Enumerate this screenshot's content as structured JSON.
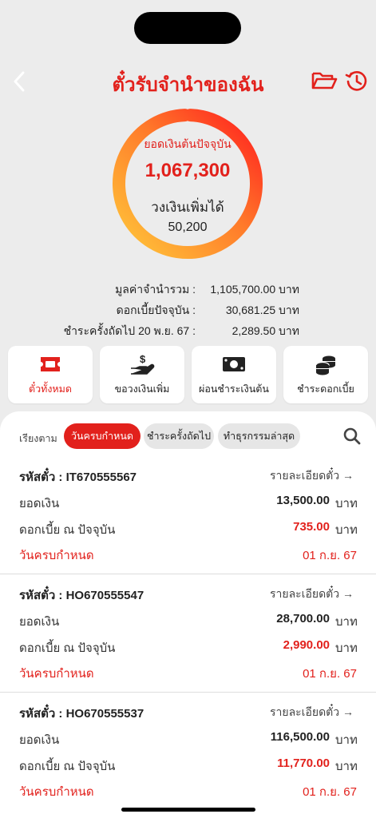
{
  "header": {
    "title": "ตั๋วรับจำนำของฉัน",
    "back_icon": "chevron-left-icon",
    "folder_icon": "folder-open-icon",
    "history_icon": "history-icon"
  },
  "summary_ring": {
    "principal_label": "ยอดเงินต้นปัจจุบัน",
    "principal_value": "1,067,300",
    "extra_label": "วงเงินเพิ่มได้",
    "extra_value": "50,200"
  },
  "summary": {
    "rows": [
      {
        "label": "มูลค่าจำนำรวม :",
        "value": "1,105,700.00 บาท"
      },
      {
        "label": "ดอกเบี้ยปัจจุบัน :",
        "value": "30,681.25 บาท"
      },
      {
        "label": "ชำระครั้งถัดไป 20 พ.ย. 67 :",
        "value": "2,289.50 บาท"
      }
    ]
  },
  "actions": [
    {
      "label": "ตั๋วทั้งหมด",
      "icon": "ticket-icon"
    },
    {
      "label": "ขอวงเงินเพิ่ม",
      "icon": "hand-money-icon"
    },
    {
      "label": "ผ่อนชำระเงินต้น",
      "icon": "banknote-icon"
    },
    {
      "label": "ชำระดอกเบี้ย",
      "icon": "coins-icon"
    }
  ],
  "sort": {
    "label": "เรียงตาม",
    "chips": [
      "วันครบกำหนด",
      "ชำระครั้งถัดไป",
      "ทำธุรกรรมล่าสุด"
    ],
    "selected": "วันครบกำหนด"
  },
  "tickets": [
    {
      "code_label": "รหัสตั๋ว : IT670555567",
      "detail": "รายละเอียดตั๋ว",
      "principal_label": "ยอดเงิน",
      "principal": "13,500.00",
      "interest_label": "ดอกเบี้ย ณ ปัจจุบัน",
      "interest": "735.00",
      "unit": "บาท",
      "due_label": "วันครบกำหนด",
      "due": "01 ก.ย. 67"
    },
    {
      "code_label": "รหัสตั๋ว : HO670555547",
      "detail": "รายละเอียดตั๋ว",
      "principal_label": "ยอดเงิน",
      "principal": "28,700.00",
      "interest_label": "ดอกเบี้ย ณ ปัจจุบัน",
      "interest": "2,990.00",
      "unit": "บาท",
      "due_label": "วันครบกำหนด",
      "due": "01 ก.ย. 67"
    },
    {
      "code_label": "รหัสตั๋ว : HO670555537",
      "detail": "รายละเอียดตั๋ว",
      "principal_label": "ยอดเงิน",
      "principal": "116,500.00",
      "interest_label": "ดอกเบี้ย ณ ปัจจุบัน",
      "interest": "11,770.00",
      "unit": "บาท",
      "due_label": "วันครบกำหนด",
      "due": "01 ก.ย. 67"
    }
  ],
  "colors": {
    "accent": "#e2211c",
    "ring_start": "#ffc73a",
    "ring_end": "#ff1e1e",
    "background": "#ececec"
  }
}
